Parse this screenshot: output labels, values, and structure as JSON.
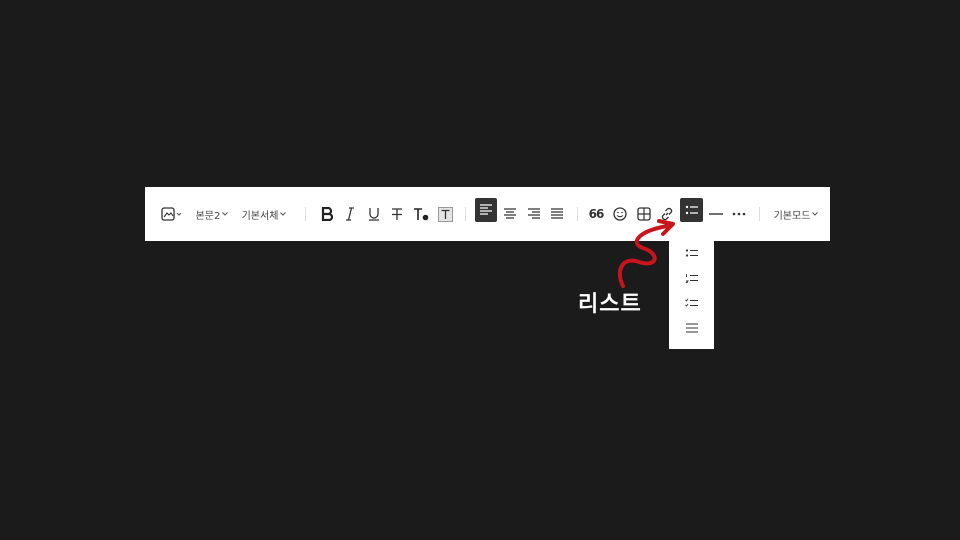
{
  "toolbar": {
    "paragraph_style": "본문2",
    "font_family": "기본서체",
    "mode": "기본모드",
    "quote_label": "66"
  },
  "annotation": {
    "label": "리스트",
    "color": "#c8151b"
  },
  "list_menu": {
    "items": [
      {
        "type": "bullet-list",
        "icon": "bullet-list-icon"
      },
      {
        "type": "numbered-list",
        "icon": "numbered-list-icon"
      },
      {
        "type": "checklist",
        "icon": "checklist-icon"
      },
      {
        "type": "no-list",
        "icon": "plain-lines-icon"
      }
    ]
  },
  "colors": {
    "background": "#1b1b1c",
    "toolbar": "#ffffff",
    "active_button": "#333333",
    "icon": "#333333"
  }
}
